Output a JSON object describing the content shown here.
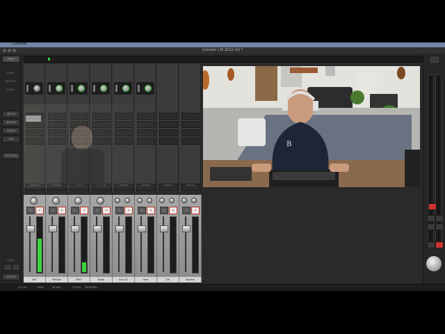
{
  "menubar": {
    "app_name": "Console"
  },
  "window": {
    "title": "Console: LM 2022 Intl *"
  },
  "sidebar": {
    "top_button": "MENU",
    "section_labels": [
      "VIEWS",
      "INSERTS",
      "SENDS"
    ],
    "buttons": [
      "INPUTS",
      "INSERTS",
      "SENDS",
      "AUX",
      "SETTINGS"
    ],
    "clear_label": "CLEAR",
    "bottom_button": "SESSION"
  },
  "monitor_labels": [
    "MONITOR",
    "MONITOR",
    "MONITOR",
    "MONITOR",
    "MONITOR",
    "MONITOR",
    "MONITOR",
    "MONITOR"
  ],
  "channels": [
    {
      "name": "U87",
      "level": 0.62,
      "fader": 0.82,
      "pan_type": "single"
    },
    {
      "name": "KM184",
      "level": 0.0,
      "fader": 0.82,
      "pan_type": "single"
    },
    {
      "name": "SM57",
      "level": 0.18,
      "fader": 0.82,
      "pan_type": "single"
    },
    {
      "name": "Rode",
      "level": 0.0,
      "fader": 0.82,
      "pan_type": "single"
    },
    {
      "name": "Aux FX",
      "level": 0.0,
      "fader": 0.82,
      "pan_type": "stereo"
    },
    {
      "name": "Verb",
      "level": 0.0,
      "fader": 0.82,
      "pan_type": "stereo"
    },
    {
      "name": "DX",
      "level": 0.0,
      "fader": 0.82,
      "pan_type": "stereo"
    },
    {
      "name": "System",
      "level": 0.0,
      "fader": 0.82,
      "pan_type": "stereo"
    }
  ],
  "mute_label": "M",
  "solo_label": "S",
  "status": {
    "rate_label": "RATE",
    "rate_value": "48 kHz",
    "clock_label": "CLOCK",
    "clock_value": "INTERNAL",
    "tempo_value": "120.00"
  },
  "colors": {
    "meter_green": "#3fd23f",
    "mute_red": "#cc2222",
    "knob_ring": "#39c439"
  },
  "icons": {
    "cam_overlay": "video-feed"
  }
}
